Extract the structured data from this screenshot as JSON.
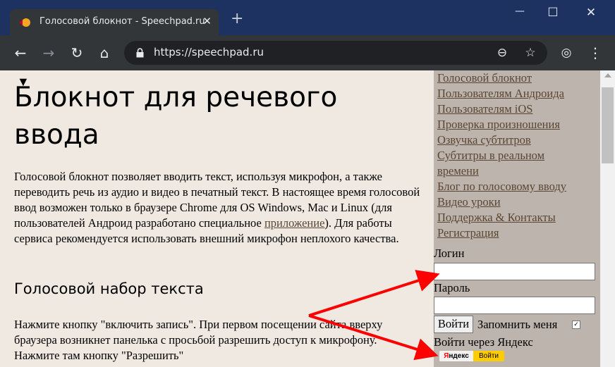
{
  "browser": {
    "tab_title": "Голосовой блокнот - Speechpad.ru",
    "tab_close": "✕",
    "new_tab": "+",
    "url": "https://speechpad.ru",
    "window": {
      "minimize": "—",
      "maximize": "☐",
      "close": "✕"
    },
    "nav": {
      "back": "←",
      "forward": "→",
      "reload": "↻",
      "home": "⌂"
    },
    "omni": {
      "zoom": "⊖",
      "star": "☆",
      "incognito": "◎",
      "menu": "⋮"
    }
  },
  "main": {
    "heading": "Блокнот для речевого ввода",
    "intro_before_link": "Голосовой блокнот позволяет вводить текст, используя микрофон, а также переводить речь из аудио и видео в печатный текст. В настоящее время голосовой ввод возможен только в браузере Chrome для OS Windows, Mac и Linux (для пользователей Андроид разработано специальное ",
    "intro_link": "приложение",
    "intro_after_link": "). Для работы сервиса рекомендуется использовать внешний микрофон неплохого качества.",
    "subheading": "Голосовой набор текста",
    "instructions": "Нажмите кнопку \"включить запись\". При первом посещении сайта вверху браузера возникнет панелька с просьбой разрешить доступ к микрофону. Нажмите там кнопку \"Разрешить\""
  },
  "sidebar": {
    "links": [
      "Голосовой блокнот",
      "Пользователям Андроида",
      "Пользователям iOS",
      "Проверка произношения",
      "Озвучка субтитров",
      "Субтитры в реальном",
      "времени",
      "Блог по голосовому вводу",
      "Видео уроки",
      "Поддержка & Контакты",
      "Регистрация"
    ],
    "login_label": "Логин",
    "login_value": "",
    "password_label": "Пароль",
    "password_value": "",
    "login_button": "Войти",
    "remember_label": "Запомнить меня",
    "remember_checked": true,
    "yandex_label": "Войти через Яндекс",
    "yandex_logo_first": "Я",
    "yandex_logo_rest": "ндекс",
    "yandex_button": "Войти"
  },
  "colors": {
    "page_bg": "#efe9e1",
    "sidebar_bg": "#bdb4ad",
    "link": "#5a4632",
    "arrow": "#ff0000"
  }
}
